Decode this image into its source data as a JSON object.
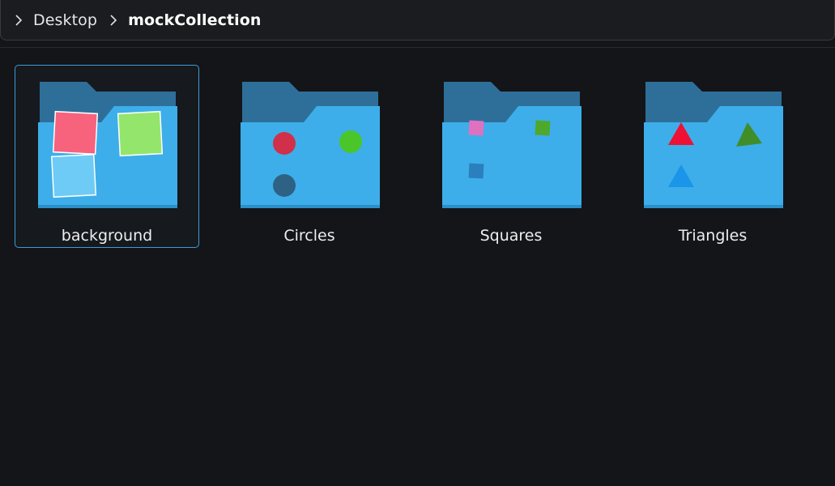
{
  "breadcrumb": {
    "items": [
      {
        "label": "Desktop",
        "current": false
      },
      {
        "label": "mockCollection",
        "current": true
      }
    ]
  },
  "folders": [
    {
      "name": "background",
      "selected": true,
      "icon": "folder-background-icon"
    },
    {
      "name": "Circles",
      "selected": false,
      "icon": "folder-circles-icon"
    },
    {
      "name": "Squares",
      "selected": false,
      "icon": "folder-squares-icon"
    },
    {
      "name": "Triangles",
      "selected": false,
      "icon": "folder-triangles-icon"
    }
  ],
  "colors": {
    "folder_back": "#2e6f9a",
    "folder_front": "#3daee9",
    "selection": "#3d9bd8",
    "background": "#141518"
  }
}
